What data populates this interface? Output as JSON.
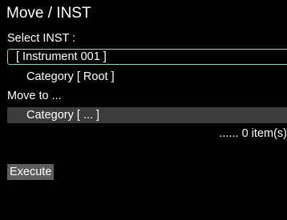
{
  "header": {
    "title": "Move / INST"
  },
  "select": {
    "label": "Select INST :",
    "instrument": "[ Instrument 001 ]",
    "category": "Category [ Root ]"
  },
  "move_to": {
    "label": "Move to ...",
    "destination": "Category [ ... ]"
  },
  "status": {
    "count": "...... 0 item(s)"
  },
  "actions": {
    "execute_label": "Execute"
  },
  "colors": {
    "background": "#000000",
    "focus_border": "#7fd8b8",
    "field_bg": "#3c3c3c",
    "button_bg": "#5e5e5e"
  }
}
